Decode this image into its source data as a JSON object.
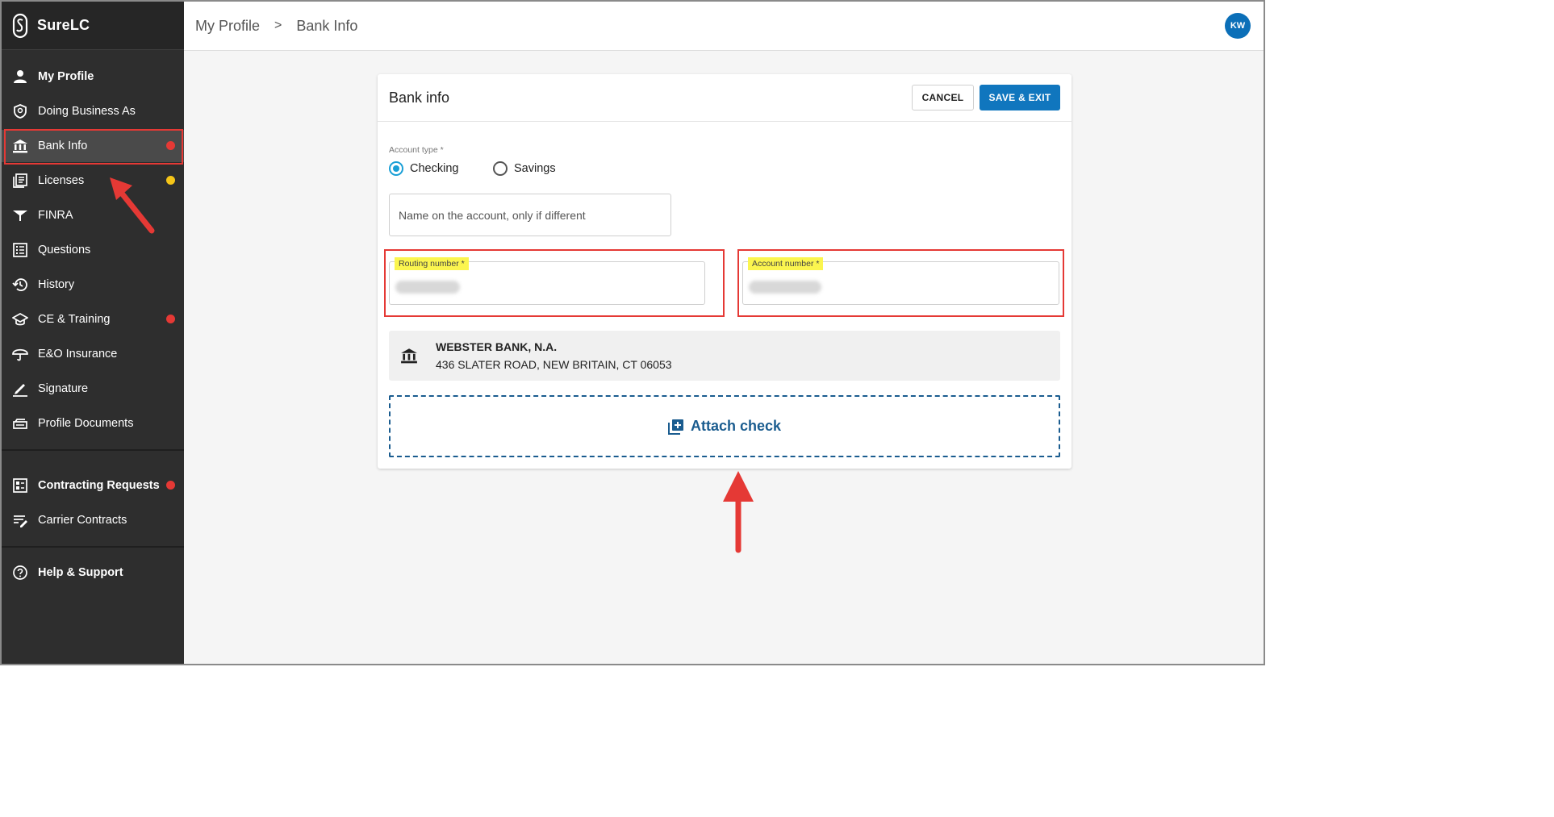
{
  "app": {
    "name": "SureLC"
  },
  "sidebar": {
    "items": [
      {
        "label": "My Profile",
        "icon": "person-icon"
      },
      {
        "label": "Doing Business As",
        "icon": "shield-icon"
      },
      {
        "label": "Bank Info",
        "icon": "bank-icon",
        "badge_color": "#e53935"
      },
      {
        "label": "Licenses",
        "icon": "licenses-icon",
        "badge_color": "#f5c518"
      },
      {
        "label": "FINRA",
        "icon": "finra-icon"
      },
      {
        "label": "Questions",
        "icon": "questions-icon"
      },
      {
        "label": "History",
        "icon": "history-icon"
      },
      {
        "label": "CE & Training",
        "icon": "graduation-cap-icon",
        "badge_color": "#e53935"
      },
      {
        "label": "E&O Insurance",
        "icon": "umbrella-icon"
      },
      {
        "label": "Signature",
        "icon": "pen-icon"
      },
      {
        "label": "Profile Documents",
        "icon": "documents-icon"
      }
    ],
    "section2": [
      {
        "label": "Contracting Requests",
        "icon": "requests-icon",
        "badge_color": "#e53935"
      },
      {
        "label": "Carrier Contracts",
        "icon": "contracts-icon"
      }
    ],
    "help": {
      "label": "Help & Support",
      "icon": "help-icon"
    }
  },
  "header": {
    "breadcrumb": [
      "My Profile",
      "Bank Info"
    ],
    "separator": ">",
    "avatar_initials": "KW"
  },
  "card": {
    "title": "Bank info",
    "cancel_label": "CANCEL",
    "save_label": "SAVE & EXIT",
    "account_type_label": "Account type *",
    "account_type_options": [
      "Checking",
      "Savings"
    ],
    "account_type_selected": "Checking",
    "name_placeholder": "Name on the account, only if different",
    "routing_label": "Routing number *",
    "account_label": "Account number *",
    "bank_name": "WEBSTER BANK, N.A.",
    "bank_address": "436 SLATER ROAD, NEW BRITAIN, CT 06053",
    "attach_label": "Attach check"
  },
  "colors": {
    "accent": "#1076be",
    "highlight": "#fbf54f",
    "annotation": "#e53935"
  }
}
